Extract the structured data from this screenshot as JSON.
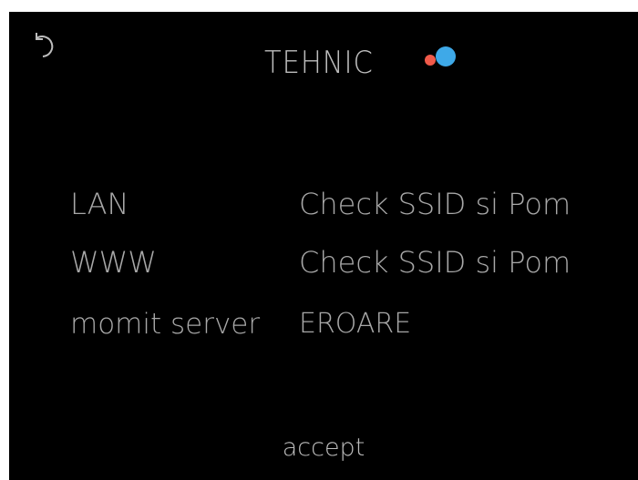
{
  "header": {
    "title": "TEHNIC",
    "back_icon": "undo-arrow-icon",
    "status_colors": {
      "red": "#f05a4a",
      "blue": "#3ea9e8"
    }
  },
  "rows": [
    {
      "label": "LAN",
      "value": "Check SSID si Pom"
    },
    {
      "label": "WWW",
      "value": "Check SSID si Pom"
    },
    {
      "label": "momit server",
      "value": "EROARE"
    }
  ],
  "footer": {
    "accept_label": "accept"
  }
}
